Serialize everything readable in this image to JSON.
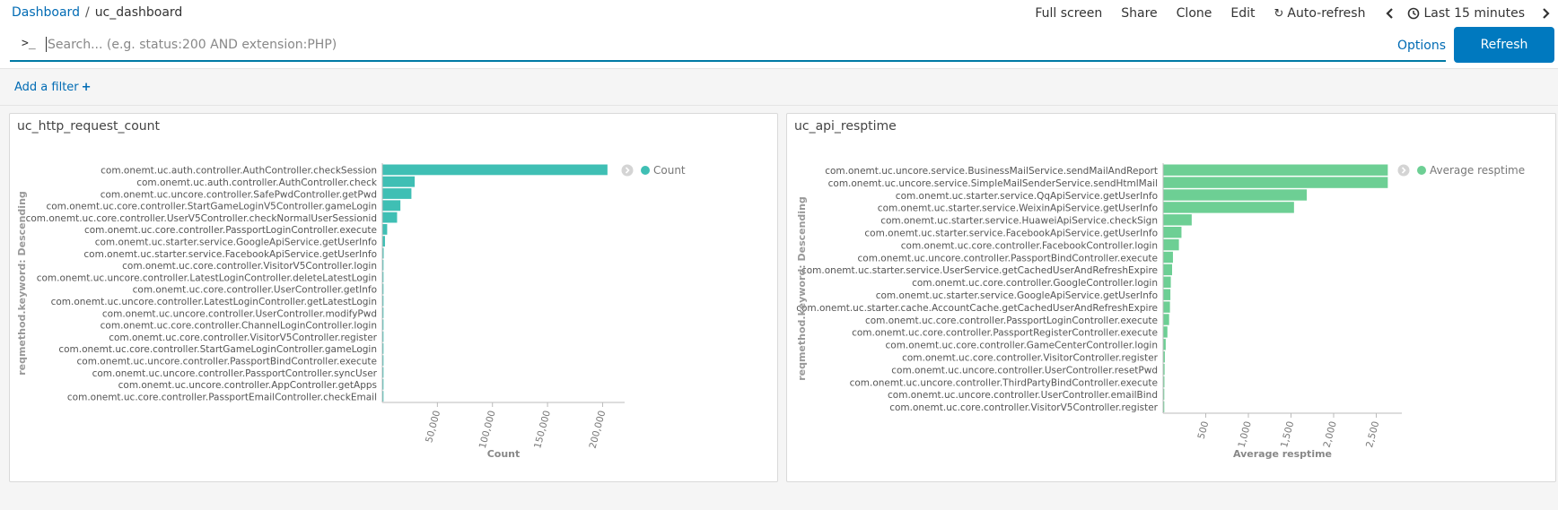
{
  "breadcrumb": {
    "root": "Dashboard",
    "separator": "/",
    "current": "uc_dashboard"
  },
  "nav": {
    "full_screen": "Full screen",
    "share": "Share",
    "clone": "Clone",
    "edit": "Edit",
    "auto_refresh": "Auto-refresh",
    "prev_icon": "chevron-left-icon",
    "time_range": "Last 15 minutes",
    "next_icon": "chevron-right-icon"
  },
  "search": {
    "prompt": ">_",
    "placeholder": "Search... (e.g. status:200 AND extension:PHP)",
    "value": "",
    "options_label": "Options",
    "refresh_label": "Refresh"
  },
  "filter": {
    "add_label": "Add a filter",
    "plus": "+"
  },
  "colors": {
    "accent": "#0079bf",
    "count_bar": "#3fbfb4",
    "resp_bar": "#6dcf94",
    "link": "#006bb4"
  },
  "panels": [
    {
      "title": "uc_http_request_count",
      "chart_data": {
        "type": "bar",
        "orientation": "horizontal",
        "ylabel": "reqmethod.keyword: Descending",
        "xlabel": "Count",
        "legend": {
          "entries": [
            "Count"
          ],
          "placement": "top-right"
        },
        "xlim": [
          0,
          220000
        ],
        "xticks": [
          50000,
          100000,
          150000,
          200000
        ],
        "xtick_labels": [
          "50,000",
          "100,000",
          "150,000",
          "200,000"
        ],
        "bar_color": "#3fbfb4",
        "categories": [
          "com.onemt.uc.auth.controller.AuthController.checkSession",
          "com.onemt.uc.auth.controller.AuthController.check",
          "com.onemt.uc.uncore.controller.SafePwdController.getPwd",
          "com.onemt.uc.core.controller.StartGameLoginV5Controller.gameLogin",
          "com.onemt.uc.core.controller.UserV5Controller.checkNormalUserSessionid",
          "com.onemt.uc.core.controller.PassportLoginController.execute",
          "com.onemt.uc.starter.service.GoogleApiService.getUserInfo",
          "com.onemt.uc.starter.service.FacebookApiService.getUserInfo",
          "com.onemt.uc.core.controller.VisitorV5Controller.login",
          "com.onemt.uc.uncore.controller.LatestLoginController.deleteLatestLogin",
          "com.onemt.uc.core.controller.UserController.getInfo",
          "com.onemt.uc.uncore.controller.LatestLoginController.getLatestLogin",
          "com.onemt.uc.uncore.controller.UserController.modifyPwd",
          "com.onemt.uc.core.controller.ChannelLoginController.login",
          "com.onemt.uc.core.controller.VisitorV5Controller.register",
          "com.onemt.uc.core.controller.StartGameLoginController.gameLogin",
          "com.onemt.uc.uncore.controller.PassportBindController.execute",
          "com.onemt.uc.uncore.controller.PassportController.syncUser",
          "com.onemt.uc.uncore.controller.AppController.getApps",
          "com.onemt.uc.core.controller.PassportEmailController.checkEmail"
        ],
        "values": [
          204000,
          29000,
          26000,
          16000,
          13000,
          4000,
          2000,
          800,
          400,
          300,
          250,
          200,
          150,
          120,
          100,
          80,
          60,
          50,
          40,
          30
        ]
      }
    },
    {
      "title": "uc_api_resptime",
      "chart_data": {
        "type": "bar",
        "orientation": "horizontal",
        "ylabel": "reqmethod.keyword: Descending",
        "xlabel": "Average resptime",
        "legend": {
          "entries": [
            "Average resptime"
          ],
          "placement": "top-right"
        },
        "xlim": [
          0,
          2800
        ],
        "xticks": [
          500,
          1000,
          1500,
          2000,
          2500
        ],
        "xtick_labels": [
          "500",
          "1,000",
          "1,500",
          "2,000",
          "2,500"
        ],
        "bar_color": "#6dcf94",
        "categories": [
          "com.onemt.uc.uncore.service.BusinessMailService.sendMailAndReport",
          "com.onemt.uc.uncore.service.SimpleMailSenderService.sendHtmlMail",
          "com.onemt.uc.starter.service.QqApiService.getUserInfo",
          "com.onemt.uc.starter.service.WeixinApiService.getUserInfo",
          "com.onemt.uc.starter.service.HuaweiApiService.checkSign",
          "com.onemt.uc.starter.service.FacebookApiService.getUserInfo",
          "com.onemt.uc.core.controller.FacebookController.login",
          "com.onemt.uc.uncore.controller.PassportBindController.execute",
          "com.onemt.uc.starter.service.UserService.getCachedUserAndRefreshExpire",
          "com.onemt.uc.core.controller.GoogleController.login",
          "com.onemt.uc.starter.service.GoogleApiService.getUserInfo",
          "com.onemt.uc.starter.cache.AccountCache.getCachedUserAndRefreshExpire",
          "com.onemt.uc.core.controller.PassportLoginController.execute",
          "com.onemt.uc.core.controller.PassportRegisterController.execute",
          "com.onemt.uc.core.controller.GameCenterController.login",
          "com.onemt.uc.core.controller.VisitorController.register",
          "com.onemt.uc.uncore.controller.UserController.resetPwd",
          "com.onemt.uc.uncore.controller.ThirdPartyBindController.execute",
          "com.onemt.uc.uncore.controller.UserController.emailBind",
          "com.onemt.uc.core.controller.VisitorV5Controller.register"
        ],
        "values": [
          2630,
          2630,
          1680,
          1530,
          330,
          210,
          180,
          110,
          100,
          85,
          80,
          75,
          65,
          45,
          25,
          15,
          12,
          10,
          8,
          5
        ]
      }
    }
  ]
}
